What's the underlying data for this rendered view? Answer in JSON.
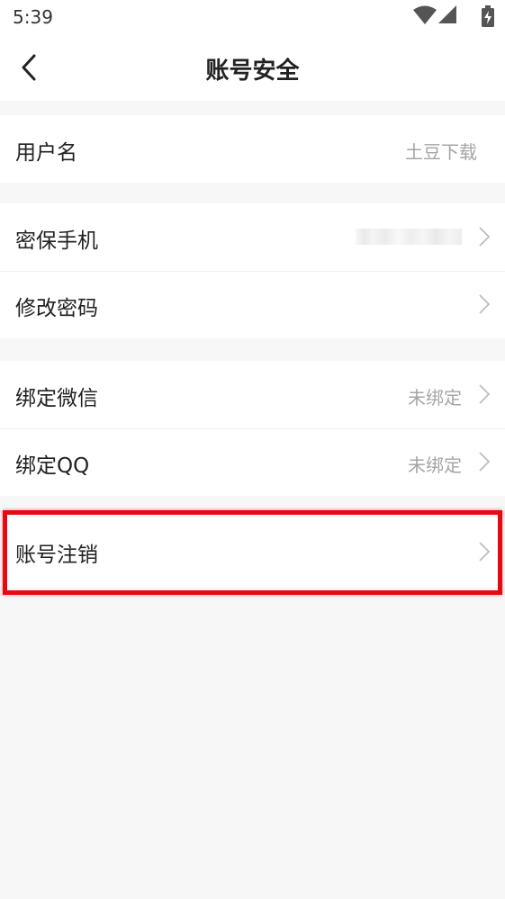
{
  "status_bar": {
    "time": "5:39",
    "icons": [
      "wifi-icon",
      "cellular-signal-icon",
      "battery-charging-icon"
    ]
  },
  "nav": {
    "title": "账号安全",
    "back_icon": "chevron-left-icon"
  },
  "groups": [
    {
      "items": [
        {
          "label": "用户名",
          "value": "土豆下载",
          "chevron": false
        }
      ]
    },
    {
      "items": [
        {
          "label": "密保手机",
          "value": "",
          "masked": true,
          "chevron": true
        },
        {
          "label": "修改密码",
          "value": "",
          "chevron": true
        }
      ]
    },
    {
      "items": [
        {
          "label": "绑定微信",
          "value": "未绑定",
          "chevron": true
        },
        {
          "label": "绑定QQ",
          "value": "未绑定",
          "chevron": true
        }
      ]
    },
    {
      "items": [
        {
          "label": "账号注销",
          "value": "",
          "chevron": true,
          "highlighted": true
        }
      ]
    }
  ],
  "colors": {
    "background": "#f7f7f7",
    "card": "#ffffff",
    "text_primary": "#222222",
    "text_secondary": "#a5a5a5",
    "highlight": "#e50914"
  }
}
